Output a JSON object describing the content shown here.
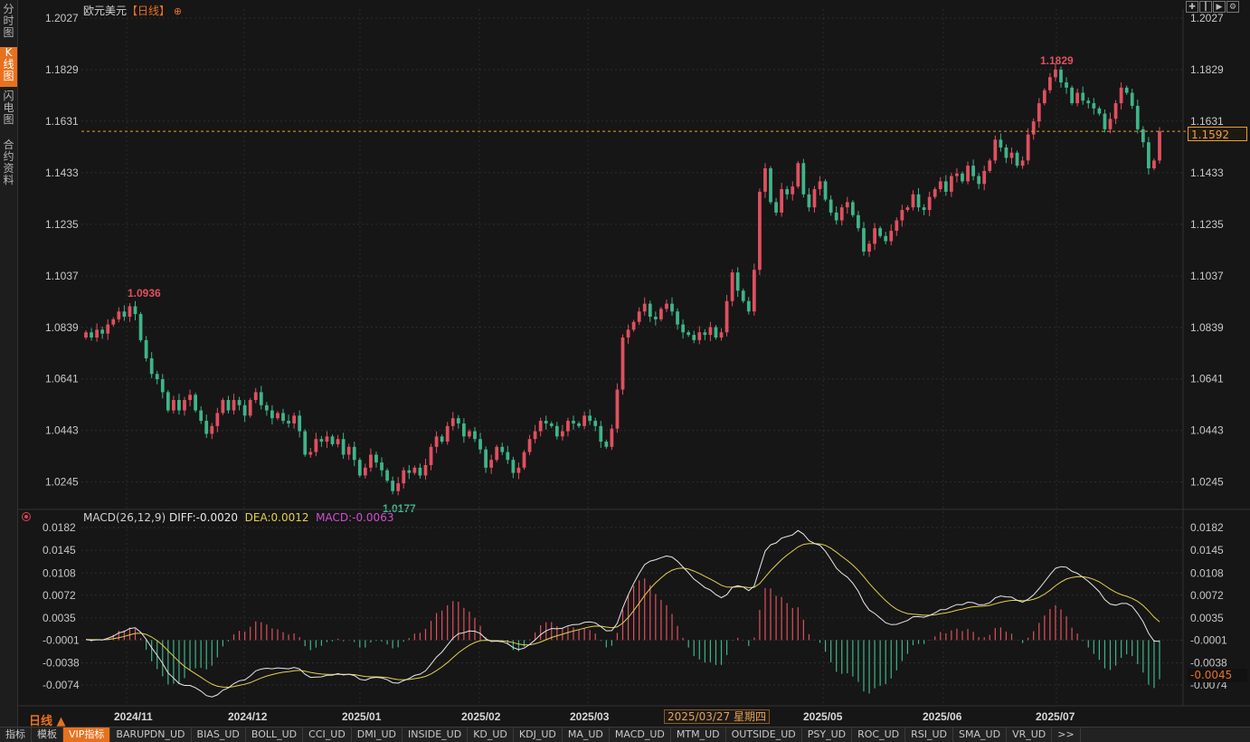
{
  "side_tabs": [
    {
      "label": "分时图",
      "active": false
    },
    {
      "label": "K线图",
      "active": true
    },
    {
      "label": "闪电图",
      "active": false
    },
    {
      "label": "合约资料",
      "active": false
    }
  ],
  "header": {
    "symbol": "欧元美元",
    "period": "【日线】",
    "add_icon": "circle-plus-icon"
  },
  "toolbar_icons": [
    "crosshair-icon",
    "bar-style-icon",
    "play-icon",
    "settings-icon"
  ],
  "price_axis": {
    "ticks": [
      "1.2027",
      "1.1829",
      "1.1631",
      "1.1433",
      "1.1235",
      "1.1037",
      "1.0839",
      "1.0641",
      "1.0443",
      "1.0245"
    ]
  },
  "markers": {
    "high_1": "1.0936",
    "low_1": "1.0177",
    "high_2": "1.1829"
  },
  "current_price": "1.1592",
  "macd": {
    "label": "MACD(26,12,9)",
    "diff": "DIFF:-0.0020",
    "dea": "DEA:0.0012",
    "macd": "MACD:-0.0063",
    "ticks": [
      "0.0182",
      "0.0145",
      "0.0108",
      "0.0072",
      "0.0035",
      "-0.0001",
      "-0.0038",
      "-0.0074"
    ],
    "current": "-0.0045"
  },
  "date_axis": [
    "2024/11",
    "2024/12",
    "2025/01",
    "2025/02",
    "2025/03",
    "2025/05",
    "2025/06",
    "2025/07"
  ],
  "cursor_date": "2025/03/27 星期四",
  "period_selector": "日线 ▲",
  "bottom_tabs": [
    "指标",
    "模板",
    "VIP指标",
    "BARUPDN_UD",
    "BIAS_UD",
    "BOLL_UD",
    "CCI_UD",
    "DMI_UD",
    "INSIDE_UD",
    "KD_UD",
    "KDJ_UD",
    "MA_UD",
    "MACD_UD",
    "MTM_UD",
    "OUTSIDE_UD",
    "PSY_UD",
    "ROC_UD",
    "RSI_UD",
    "SMA_UD",
    "VR_UD",
    ">>"
  ],
  "colors": {
    "up": "#e0505f",
    "down": "#3fb489",
    "dea": "#e5d04a",
    "diff": "#e8e8e8",
    "accent": "#e8711e"
  },
  "chart_data": {
    "type": "candlestick",
    "title": "欧元美元【日线】",
    "ylim": [
      1.015,
      1.2027
    ],
    "closes": [
      1.082,
      1.08,
      1.083,
      1.0815,
      1.085,
      1.087,
      1.09,
      1.088,
      1.092,
      1.089,
      1.079,
      1.072,
      1.066,
      1.064,
      1.059,
      1.052,
      1.056,
      1.052,
      1.056,
      1.058,
      1.052,
      1.048,
      1.043,
      1.046,
      1.051,
      1.056,
      1.052,
      1.056,
      1.054,
      1.05,
      1.056,
      1.059,
      1.054,
      1.052,
      1.049,
      1.051,
      1.048,
      1.047,
      1.05,
      1.044,
      1.035,
      1.036,
      1.041,
      1.04,
      1.042,
      1.039,
      1.041,
      1.035,
      1.038,
      1.033,
      1.027,
      1.03,
      1.035,
      1.032,
      1.029,
      1.025,
      1.021,
      1.024,
      1.029,
      1.028,
      1.03,
      1.027,
      1.031,
      1.038,
      1.042,
      1.04,
      1.046,
      1.049,
      1.047,
      1.042,
      1.044,
      1.041,
      1.037,
      1.03,
      1.033,
      1.038,
      1.036,
      1.033,
      1.028,
      1.03,
      1.036,
      1.041,
      1.044,
      1.048,
      1.047,
      1.046,
      1.042,
      1.044,
      1.048,
      1.047,
      1.046,
      1.05,
      1.048,
      1.046,
      1.04,
      1.038,
      1.045,
      1.06,
      1.08,
      1.083,
      1.086,
      1.09,
      1.093,
      1.088,
      1.087,
      1.091,
      1.093,
      1.09,
      1.085,
      1.082,
      1.081,
      1.079,
      1.082,
      1.081,
      1.084,
      1.08,
      1.082,
      1.094,
      1.105,
      1.098,
      1.094,
      1.09,
      1.106,
      1.136,
      1.145,
      1.132,
      1.128,
      1.137,
      1.135,
      1.138,
      1.147,
      1.135,
      1.13,
      1.137,
      1.14,
      1.133,
      1.128,
      1.125,
      1.13,
      1.132,
      1.127,
      1.122,
      1.113,
      1.116,
      1.122,
      1.119,
      1.117,
      1.121,
      1.125,
      1.129,
      1.13,
      1.135,
      1.13,
      1.129,
      1.134,
      1.137,
      1.14,
      1.136,
      1.142,
      1.143,
      1.14,
      1.146,
      1.142,
      1.139,
      1.144,
      1.148,
      1.156,
      1.153,
      1.149,
      1.151,
      1.146,
      1.148,
      1.158,
      1.163,
      1.17,
      1.175,
      1.18,
      1.1829,
      1.178,
      1.176,
      1.17,
      1.174,
      1.171,
      1.17,
      1.168,
      1.166,
      1.16,
      1.164,
      1.17,
      1.176,
      1.174,
      1.169,
      1.16,
      1.155,
      1.145,
      1.148,
      1.1592
    ],
    "date_axis": [
      "2024/11",
      "2024/12",
      "2025/01",
      "2025/02",
      "2025/03",
      "2025/05",
      "2025/06",
      "2025/07"
    ],
    "annotations": [
      "1.0936",
      "1.0177",
      "1.1829"
    ],
    "indicator": {
      "name": "MACD(26,12,9)",
      "diff": -0.002,
      "dea": 0.0012,
      "macd": -0.0063,
      "ylim": [
        -0.009,
        0.0195
      ]
    }
  }
}
